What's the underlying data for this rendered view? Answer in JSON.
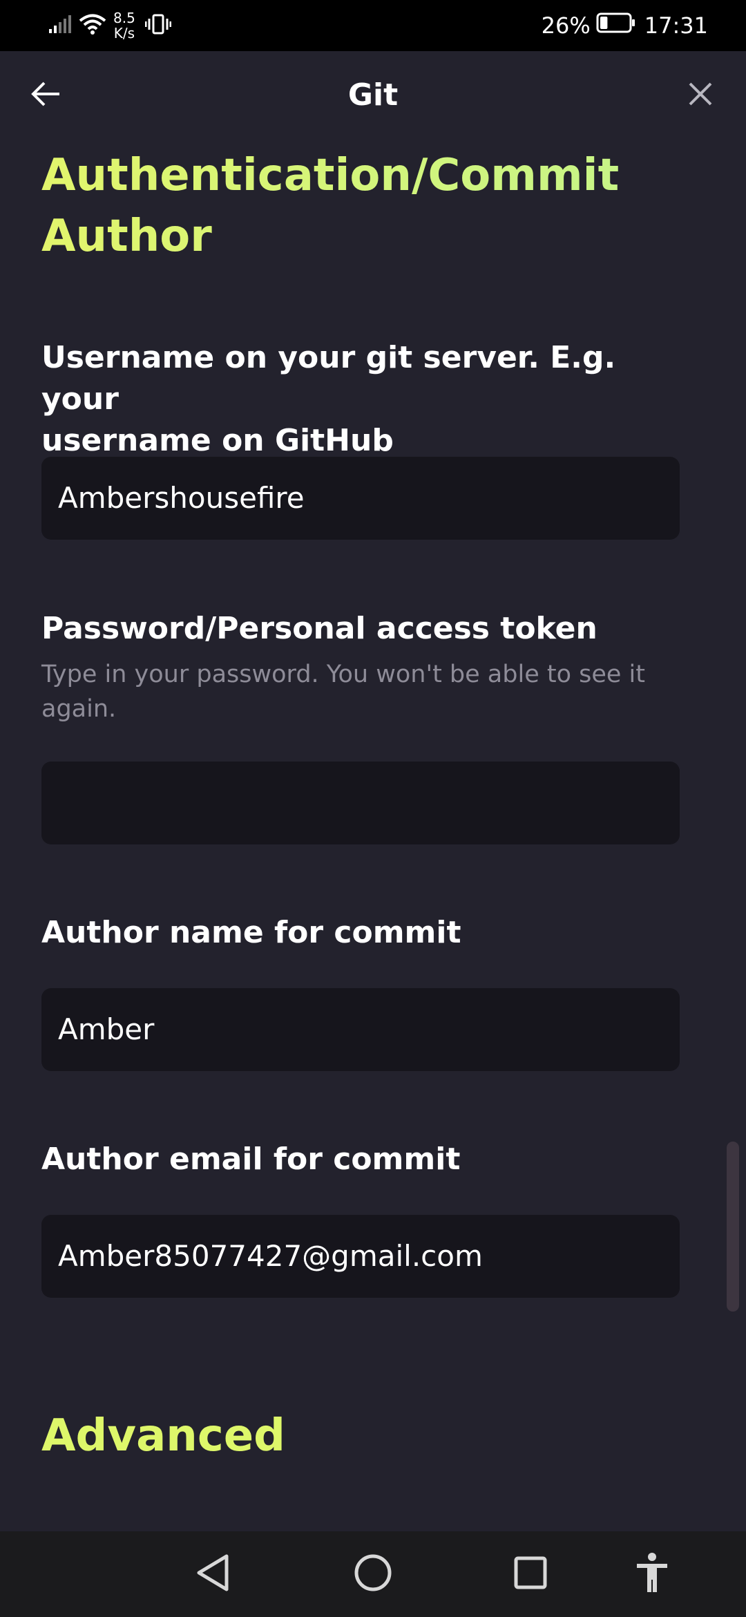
{
  "status_bar": {
    "speed_value": "8.5",
    "speed_unit": "K/s",
    "battery_percent": "26%",
    "battery_level": 0.26,
    "time": "17:31"
  },
  "app_bar": {
    "title": "Git"
  },
  "sections": {
    "auth_heading_line1": "Authentication/Commit",
    "auth_heading_line2": "Author",
    "advanced_heading": "Advanced"
  },
  "fields": {
    "username": {
      "label_line1": "Username on your git server. E.g. your",
      "label_line2": "username on GitHub",
      "value": "Ambershousefire"
    },
    "password": {
      "label": "Password/Personal access token",
      "hint_line1": "Type in your password. You won't be able to see it",
      "hint_line2": "again.",
      "value": ""
    },
    "author_name": {
      "label": "Author name for commit",
      "value": "Amber"
    },
    "author_email": {
      "label": "Author email for commit",
      "value": "Amber85077427@gmail.com"
    }
  },
  "colors": {
    "background": "#23222d",
    "accent": "#d8f26a",
    "input_bg": "#16151c"
  }
}
